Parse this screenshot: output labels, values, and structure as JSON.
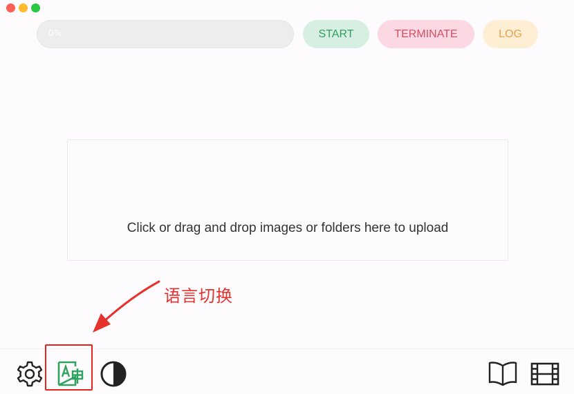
{
  "toolbar": {
    "progress": {
      "value_percent": 0,
      "label": "0%"
    },
    "start_label": "START",
    "terminate_label": "TERMINATE",
    "log_label": "LOG"
  },
  "dropzone": {
    "text": "Click or drag and drop images or folders here to upload"
  },
  "annotation": {
    "text": "语言切换",
    "color": "#e5322d"
  },
  "bottom_bar": {
    "left_icons": [
      "gear-icon",
      "language-switch-icon",
      "theme-contrast-icon"
    ],
    "right_icons": [
      "book-icon",
      "film-icon"
    ]
  },
  "colors": {
    "start": "#2f9e5c",
    "terminate": "#d64d64",
    "log": "#e7a04f",
    "language_icon": "#2fa35e"
  }
}
